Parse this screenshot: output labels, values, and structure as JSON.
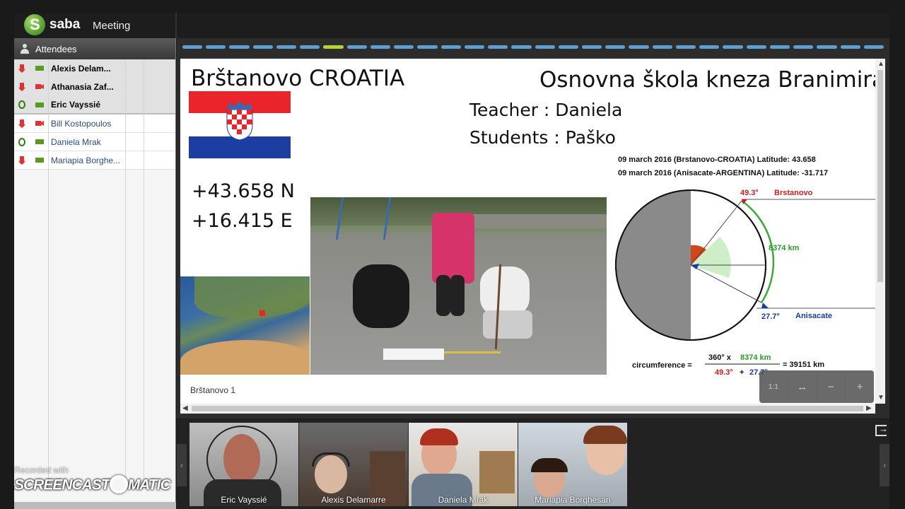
{
  "header": {
    "brand": "saba",
    "product": "Meeting"
  },
  "attendees": {
    "title": "Attendees",
    "items": [
      {
        "name": "Alexis Delam...",
        "mic": "red",
        "cam": "green",
        "group": 1
      },
      {
        "name": "Athanasia Zaf...",
        "mic": "red",
        "cam": "red",
        "group": 1
      },
      {
        "name": "Eric Vayssié",
        "mic": "green",
        "cam": "green",
        "group": 1
      },
      {
        "name": "Bill Kostopoulos",
        "mic": "red",
        "cam": "red",
        "group": 2
      },
      {
        "name": "Daniela Mrak",
        "mic": "green",
        "cam": "green",
        "group": 2
      },
      {
        "name": "Mariapia Borghe...",
        "mic": "red",
        "cam": "green",
        "group": 2
      }
    ]
  },
  "watermark": {
    "line1": "Recorded with",
    "line2a": "SCREENCAST",
    "line2b": "MATIC"
  },
  "slide": {
    "title_left": "Brštanovo CROATIA",
    "title_right": "Osnovna škola kneza Branimira",
    "teacher": "Teacher : Daniela",
    "students": "Students : Paško",
    "coord_n": "+43.658 N",
    "coord_e": "+16.415 E",
    "info1": "09 march 2016 (Brstanovo-CROATIA) Latitude:  43.658",
    "info2": "09 march 2016 (Anisacate-ARGENTINA) Latitude: -31.717",
    "angle_top": "49.3°",
    "label_top": "Brstanovo",
    "distance": "8374 km",
    "angle_bottom": "27.7°",
    "label_bottom": "Anisacate",
    "circ_label": "circumference =",
    "circ_num": "360° x",
    "circ_num_km": "8374 km",
    "circ_den_a": "49.3°",
    "circ_den_plus": "+",
    "circ_den_b": "27.7°",
    "circ_result": "= 39151 km",
    "footer": "Brštanovo 1",
    "progress_active_index": 6,
    "progress_segments": 30
  },
  "zoom": {
    "fit": "1:1",
    "width": "↔",
    "out": "−",
    "in": "+"
  },
  "videos": [
    {
      "name": "Eric Vayssié"
    },
    {
      "name": "Alexis Delamarre"
    },
    {
      "name": "Daniela Mrak"
    },
    {
      "name": "Mariapia Borghesan"
    }
  ],
  "colors": {
    "accent_blue": "#5d9fd0",
    "accent_green": "#b4d33a",
    "mic_red": "#dd3333",
    "ok_green": "#5a9a20"
  }
}
